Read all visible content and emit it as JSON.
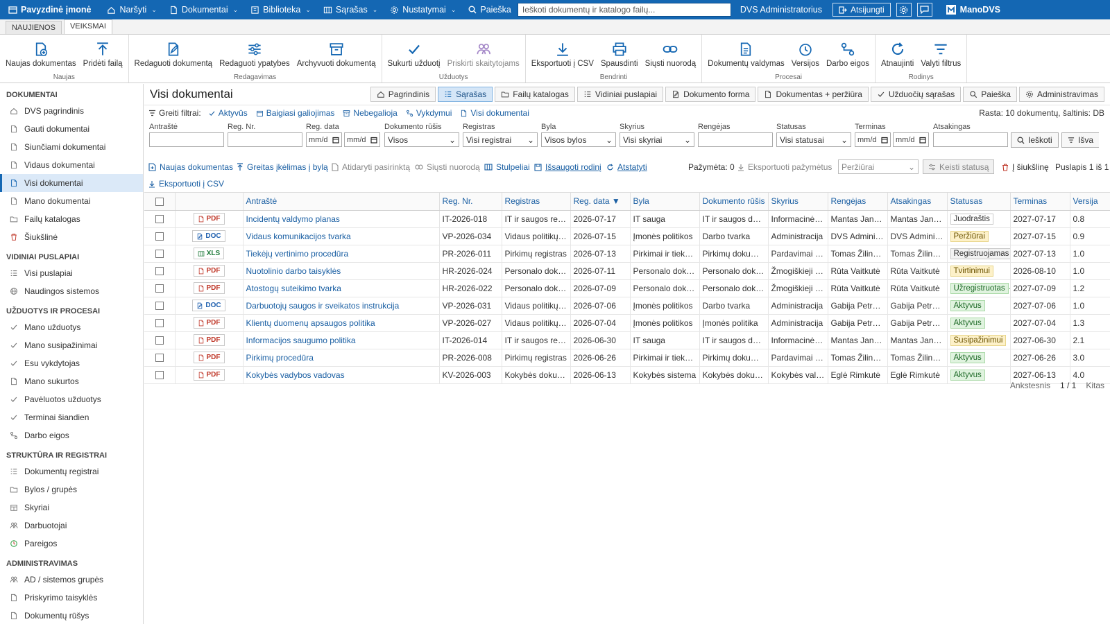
{
  "topbar": {
    "company": "Pavyzdinė įmonė",
    "menu": [
      {
        "label": "Naršyti",
        "icon": "home-icon"
      },
      {
        "label": "Dokumentai",
        "icon": "document-icon"
      },
      {
        "label": "Biblioteka",
        "icon": "library-icon"
      },
      {
        "label": "Sąrašas",
        "icon": "columns-icon"
      },
      {
        "label": "Nustatymai",
        "icon": "gear-icon"
      }
    ],
    "search_label": "Paieška",
    "search_placeholder": "Ieškoti dokumentų ir katalogo failų...",
    "user": "DVS Administratorius",
    "logout": "Atsijungti",
    "product": "ManoDVS"
  },
  "ribbon_tabs": [
    "NAUJIENOS",
    "VEIKSMAI"
  ],
  "ribbon": {
    "groups": [
      {
        "name": "Naujas",
        "buttons": [
          {
            "label": "Naujas dokumentas",
            "icon": "new-document-icon"
          },
          {
            "label": "Pridėti failą",
            "icon": "upload-icon"
          }
        ]
      },
      {
        "name": "Redagavimas",
        "buttons": [
          {
            "label": "Redaguoti dokumentą",
            "icon": "edit-document-icon"
          },
          {
            "label": "Redaguoti ypatybes",
            "icon": "sliders-icon"
          },
          {
            "label": "Archyvuoti dokumentą",
            "icon": "archive-icon"
          }
        ]
      },
      {
        "name": "Užduotys",
        "buttons": [
          {
            "label": "Sukurti užduotį",
            "icon": "check-icon"
          },
          {
            "label": "Priskirti skaitytojams",
            "icon": "users-icon"
          }
        ]
      },
      {
        "name": "Bendrinti",
        "buttons": [
          {
            "label": "Eksportuoti į CSV",
            "icon": "download-icon"
          },
          {
            "label": "Spausdinti",
            "icon": "printer-icon"
          },
          {
            "label": "Siųsti nuorodą",
            "icon": "link-icon"
          }
        ]
      },
      {
        "name": "Procesai",
        "buttons": [
          {
            "label": "Dokumentų valdymas",
            "icon": "document-manage-icon"
          },
          {
            "label": "Versijos",
            "icon": "history-icon"
          },
          {
            "label": "Darbo eigos",
            "icon": "workflow-icon"
          }
        ]
      },
      {
        "name": "Rodinys",
        "buttons": [
          {
            "label": "Atnaujinti",
            "icon": "refresh-icon"
          },
          {
            "label": "Valyti filtrus",
            "icon": "filter-clear-icon"
          }
        ]
      }
    ]
  },
  "sidebar": {
    "sections": [
      {
        "title": "DOKUMENTAI",
        "items": [
          {
            "label": "DVS pagrindinis",
            "icon": "home-icon"
          },
          {
            "label": "Gauti dokumentai",
            "icon": "document-icon"
          },
          {
            "label": "Siunčiami dokumentai",
            "icon": "document-icon"
          },
          {
            "label": "Vidaus dokumentai",
            "icon": "document-icon"
          },
          {
            "label": "Visi dokumentai",
            "icon": "document-icon",
            "active": true
          },
          {
            "label": "Mano dokumentai",
            "icon": "document-icon"
          },
          {
            "label": "Failų katalogas",
            "icon": "folder-icon"
          },
          {
            "label": "Šiukšlinė",
            "icon": "trash-icon"
          }
        ]
      },
      {
        "title": "VIDINIAI PUSLAPIAI",
        "items": [
          {
            "label": "Visi puslapiai",
            "icon": "list-icon"
          },
          {
            "label": "Naudingos sistemos",
            "icon": "globe-icon"
          }
        ]
      },
      {
        "title": "UŽDUOTYS IR PROCESAI",
        "items": [
          {
            "label": "Mano užduotys",
            "icon": "check-icon"
          },
          {
            "label": "Mano susipažinimai",
            "icon": "check-icon"
          },
          {
            "label": "Esu vykdytojas",
            "icon": "check-icon"
          },
          {
            "label": "Mano sukurtos",
            "icon": "document-icon"
          },
          {
            "label": "Pavėluotos užduotys",
            "icon": "check-icon"
          },
          {
            "label": "Terminai šiandien",
            "icon": "check-icon"
          },
          {
            "label": "Darbo eigos",
            "icon": "workflow-icon"
          }
        ]
      },
      {
        "title": "STRUKTŪRA IR REGISTRAI",
        "items": [
          {
            "label": "Dokumentų registrai",
            "icon": "list-icon"
          },
          {
            "label": "Bylos / grupės",
            "icon": "folder-icon"
          },
          {
            "label": "Skyriai",
            "icon": "building-icon"
          },
          {
            "label": "Darbuotojai",
            "icon": "users-icon"
          },
          {
            "label": "Pareigos",
            "icon": "role-icon"
          }
        ]
      },
      {
        "title": "ADMINISTRAVIMAS",
        "items": [
          {
            "label": "AD / sistemos grupės",
            "icon": "users-icon"
          },
          {
            "label": "Priskyrimo taisyklės",
            "icon": "document-icon"
          },
          {
            "label": "Dokumentų rūšys",
            "icon": "document-icon"
          }
        ]
      }
    ]
  },
  "main": {
    "title": "Visi dokumentai",
    "view_tabs": [
      {
        "label": "Pagrindinis",
        "icon": "home-icon"
      },
      {
        "label": "Sąrašas",
        "icon": "list-icon",
        "active": true
      },
      {
        "label": "Failų katalogas",
        "icon": "folder-icon"
      },
      {
        "label": "Vidiniai puslapiai",
        "icon": "list-icon"
      },
      {
        "label": "Dokumento forma",
        "icon": "edit-document-icon"
      },
      {
        "label": "Dokumentas + peržiūra",
        "icon": "document-icon"
      },
      {
        "label": "Užduočių sąrašas",
        "icon": "check-icon"
      },
      {
        "label": "Paieška",
        "icon": "search-icon"
      },
      {
        "label": "Administravimas",
        "icon": "gear-icon"
      }
    ],
    "quick_filters_label": "Greiti filtrai:",
    "quick_filters": [
      {
        "label": "Aktyvūs",
        "icon": "check-icon"
      },
      {
        "label": "Baigiasi galiojimas",
        "icon": "calendar-icon"
      },
      {
        "label": "Nebegalioja",
        "icon": "archive-icon"
      },
      {
        "label": "Vykdymui",
        "icon": "workflow-icon"
      },
      {
        "label": "Visi dokumentai",
        "icon": "document-icon"
      }
    ],
    "rows_info": "Rasta: 10 dokumentų, šaltinis: DB",
    "fields": {
      "antraste": {
        "label": "Antraštė",
        "value": ""
      },
      "reg_nr": {
        "label": "Reg. Nr.",
        "value": ""
      },
      "reg_data": {
        "label": "Reg. data",
        "from": "mm/d",
        "to": "mm/d"
      },
      "rusis": {
        "label": "Dokumento rūšis",
        "value": "Visos"
      },
      "registras": {
        "label": "Registras",
        "value": "Visi registrai"
      },
      "byla": {
        "label": "Byla",
        "value": "Visos bylos"
      },
      "skyrius": {
        "label": "Skyrius",
        "value": "Visi skyriai"
      },
      "rengejas": {
        "label": "Rengėjas",
        "value": ""
      },
      "statusas": {
        "label": "Statusas",
        "value": "Visi statusai"
      },
      "terminas": {
        "label": "Terminas",
        "from": "mm/d",
        "to": "mm/d"
      },
      "atsakingas": {
        "label": "Atsakingas",
        "value": ""
      },
      "search_btn": "Ieškoti",
      "clear_btn": "Išva"
    },
    "actions": {
      "new_doc": "Naujas dokumentas",
      "quick_upload": "Greitas įkėlimas į bylą",
      "open_selected": "Atidaryti pasirinktą",
      "send_link": "Siųsti nuorodą",
      "columns": "Stulpeliai",
      "save_view": "Išsaugoti rodinį",
      "reset": "Atstatyti",
      "marked": "Pažymėta: 0",
      "export_marked": "Eksportuoti pažymėtus",
      "preview_select": "Peržiūrai",
      "change_status": "Keisti statusą",
      "to_trash": "Į šiukšlinę",
      "page_info": "Puslapis 1 iš 1",
      "export_csv": "Eksportuoti į CSV"
    },
    "table": {
      "headers": [
        "",
        "",
        "Antraštė",
        "Reg. Nr.",
        "Registras",
        "Reg. data ▼",
        "Byla",
        "Dokumento rūšis",
        "Skyrius",
        "Rengėjas",
        "Atsakingas",
        "Statusas",
        "Terminas",
        "Versija"
      ],
      "rows": [
        {
          "type": "PDF",
          "title": "Incidentų valdymo planas",
          "reg_nr": "IT-2026-018",
          "registras": "IT ir saugos registras",
          "reg_data": "2026-07-17",
          "byla": "IT sauga",
          "rusis": "IT ir saugos dokumentai",
          "skyrius": "Informacinės technologijos",
          "rengejas": "Mantas Jankauskas",
          "atsakingas": "Mantas Jankauskas",
          "statusas": "Juodraštis",
          "status_class": "juodrastis",
          "terminas": "2027-07-17",
          "versija": "0.8"
        },
        {
          "type": "DOC",
          "title": "Vidaus komunikacijos tvarka",
          "reg_nr": "VP-2026-034",
          "registras": "Vidaus politikų registras",
          "reg_data": "2026-07-15",
          "byla": "Įmonės politikos",
          "rusis": "Darbo tvarka",
          "skyrius": "Administracija",
          "rengejas": "DVS Administratorius",
          "atsakingas": "DVS Administratorius",
          "statusas": "Peržiūrai",
          "status_class": "perziurai",
          "terminas": "2027-07-15",
          "versija": "0.9"
        },
        {
          "type": "XLS",
          "title": "Tiekėjų vertinimo procedūra",
          "reg_nr": "PR-2026-011",
          "registras": "Pirkimų registras",
          "reg_data": "2026-07-13",
          "byla": "Pirkimai ir tiekėjai",
          "rusis": "Pirkimų dokumentai",
          "skyrius": "Pardavimai ir pirkimai",
          "rengejas": "Tomas Žilinskas",
          "atsakingas": "Tomas Žilinskas",
          "statusas": "Registruojamas",
          "status_class": "registruojamas",
          "terminas": "2027-07-13",
          "versija": "1.0"
        },
        {
          "type": "PDF",
          "title": "Nuotolinio darbo taisyklės",
          "reg_nr": "HR-2026-024",
          "registras": "Personalo dokumentai",
          "reg_data": "2026-07-11",
          "byla": "Personalo dokumentai",
          "rusis": "Personalo dokumentai",
          "skyrius": "Žmogiškieji ištekliai",
          "rengejas": "Rūta Vaitkutė",
          "atsakingas": "Rūta Vaitkutė",
          "statusas": "Tvirtinimui",
          "status_class": "tvirtinimui",
          "terminas": "2026-08-10",
          "versija": "1.0"
        },
        {
          "type": "PDF",
          "title": "Atostogų suteikimo tvarka",
          "reg_nr": "HR-2026-022",
          "registras": "Personalo dokumentai",
          "reg_data": "2026-07-09",
          "byla": "Personalo dokumentai",
          "rusis": "Personalo dokumentai",
          "skyrius": "Žmogiškieji ištekliai",
          "rengejas": "Rūta Vaitkutė",
          "atsakingas": "Rūta Vaitkutė",
          "statusas": "Užregistruotas",
          "status_class": "uzregistruotas",
          "terminas": "2027-07-09",
          "versija": "1.2"
        },
        {
          "type": "DOC",
          "title": "Darbuotojų saugos ir sveikatos instrukcija",
          "reg_nr": "VP-2026-031",
          "registras": "Vidaus politikų registras",
          "reg_data": "2026-07-06",
          "byla": "Įmonės politikos",
          "rusis": "Darbo tvarka",
          "skyrius": "Administracija",
          "rengejas": "Gabija Petrauskaitė",
          "atsakingas": "Gabija Petrauskaitė",
          "statusas": "Aktyvus",
          "status_class": "aktyvus",
          "terminas": "2027-07-06",
          "versija": "1.0"
        },
        {
          "type": "PDF",
          "title": "Klientų duomenų apsaugos politika",
          "reg_nr": "VP-2026-027",
          "registras": "Vidaus politikų registras",
          "reg_data": "2026-07-04",
          "byla": "Įmonės politikos",
          "rusis": "Įmonės politika",
          "skyrius": "Administracija",
          "rengejas": "Gabija Petrauskaitė",
          "atsakingas": "Gabija Petrauskaitė",
          "statusas": "Aktyvus",
          "status_class": "aktyvus",
          "terminas": "2027-07-04",
          "versija": "1.3"
        },
        {
          "type": "PDF",
          "title": "Informacijos saugumo politika",
          "reg_nr": "IT-2026-014",
          "registras": "IT ir saugos registras",
          "reg_data": "2026-06-30",
          "byla": "IT sauga",
          "rusis": "IT ir saugos dokumentai",
          "skyrius": "Informacinės technologijos",
          "rengejas": "Mantas Jankauskas",
          "atsakingas": "Mantas Jankauskas",
          "statusas": "Susipažinimui",
          "status_class": "susipazinimui",
          "terminas": "2027-06-30",
          "versija": "2.1"
        },
        {
          "type": "PDF",
          "title": "Pirkimų procedūra",
          "reg_nr": "PR-2026-008",
          "registras": "Pirkimų registras",
          "reg_data": "2026-06-26",
          "byla": "Pirkimai ir tiekėjai",
          "rusis": "Pirkimų dokumentai",
          "skyrius": "Pardavimai ir pirkimai",
          "rengejas": "Tomas Žilinskas",
          "atsakingas": "Tomas Žilinskas",
          "statusas": "Aktyvus",
          "status_class": "aktyvus",
          "terminas": "2027-06-26",
          "versija": "3.0"
        },
        {
          "type": "PDF",
          "title": "Kokybės vadybos vadovas",
          "reg_nr": "KV-2026-003",
          "registras": "Kokybės dokumentai",
          "reg_data": "2026-06-13",
          "byla": "Kokybės sistema",
          "rusis": "Kokybės dokumentai",
          "skyrius": "Kokybės valdymas",
          "rengejas": "Eglė Rimkutė",
          "atsakingas": "Eglė Rimkutė",
          "statusas": "Aktyvus",
          "status_class": "aktyvus",
          "terminas": "2027-06-13",
          "versija": "4.0"
        }
      ]
    },
    "pager": {
      "prev": "Ankstesnis",
      "current": "1 / 1",
      "next": "Kitas"
    }
  }
}
